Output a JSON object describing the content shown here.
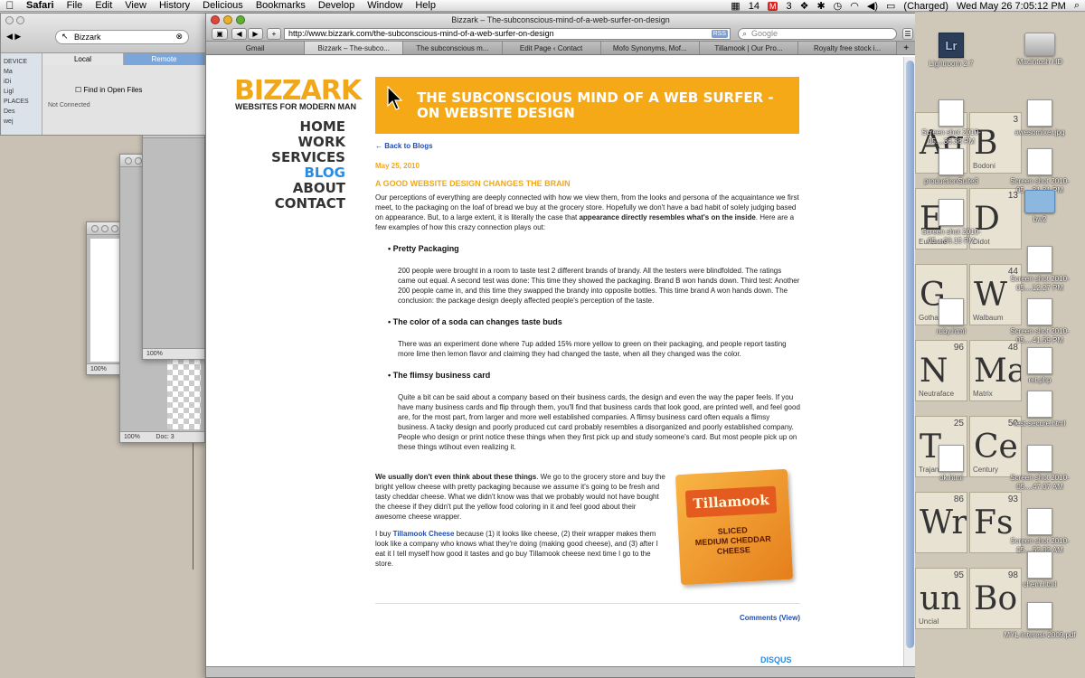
{
  "menubar": {
    "app": "Safari",
    "items": [
      "File",
      "Edit",
      "View",
      "History",
      "Delicious",
      "Bookmarks",
      "Develop",
      "Window",
      "Help"
    ],
    "status": {
      "mail_count": "14",
      "count2": "3",
      "battery": "(Charged)",
      "clock": "Wed May 26  7:05:12 PM"
    }
  },
  "finder": {
    "search_value": "Bizzark",
    "devices_label": "DEVICE",
    "places_label": "PLACES",
    "side_items": [
      "Ma",
      "iDi",
      "Ligl",
      "Des",
      "wej"
    ],
    "tabs": [
      "Local",
      "Remote"
    ],
    "find_in_open_files": "Find in Open Files",
    "status": "Not Connected"
  },
  "bg_windows": {
    "zoom_a": "100%",
    "zoom_b": "100%",
    "zoom_c": "100%",
    "doc": "Doc: 3"
  },
  "safari": {
    "title": "Bizzark – The-subconscious-mind-of-a-web-surfer-on-design",
    "url": "http://www.bizzark.com/the-subconscious-mind-of-a-web-surfer-on-design",
    "rss": "RSS",
    "search_placeholder": "Google",
    "tabs": [
      "Gmail",
      "Bizzark – The-subco...",
      "The subconscious m...",
      "Edit Page ‹ Contact",
      "Mofo Synonyms, Mof...",
      "Tillamook | Our Pro...",
      "Royalty free stock i..."
    ]
  },
  "site": {
    "logo": "BIZZARK",
    "tagline": "WEBSITES FOR MODERN MAN",
    "nav": [
      "HOME",
      "WORK",
      "SERVICES",
      "BLOG",
      "ABOUT",
      "CONTACT"
    ],
    "banner_title": "THE SUBCONSCIOUS MIND OF A WEB SURFER - ON WEBSITE DESIGN",
    "back_link": "← Back to Blogs",
    "date": "May 25, 2010",
    "post_heading": "A GOOD WEBSITE DESIGN CHANGES THE BRAIN",
    "intro": "Our perceptions of everything are deeply connected with how we view them, from the looks and persona of the acquaintance we first meet, to the packaging on the loaf of bread we buy at the grocery store. Hopefully we don't have a bad habit of solely judging based on appearance. But, to a large extent, it is literally the case that ",
    "intro_bold": "appearance directly resembles what's on the inside",
    "intro_tail": ". Here are a few examples of how this crazy connection plays out:",
    "bullets": [
      {
        "title": "Pretty Packaging",
        "text": "200 people were brought in a room to taste test 2 different brands of brandy. All the testers were blindfolded. The ratings came out equal. A second test was done: This time they showed the packaging. Brand B won hands down. Third test:  Another 200 people came in, and this time they swapped the brandy into opposite bottles. This time brand A won hands down. The conclusion: the package design deeply affected people's perception of the taste."
      },
      {
        "title": "The color of a soda can changes taste buds",
        "text": "There was an experiment done where 7up added 15% more yellow to green on their packaging, and people report tasting more lime then lemon flavor and claiming they had changed the taste, when all they changed was the color."
      },
      {
        "title": "The flimsy business card",
        "text": "Quite a bit can be said about a company based on their business cards, the design and even the way the paper feels. If you have many business cards and flip through them, you'll find that business cards that look good, are printed well, and feel good are, for the most part, from larger and more well established companies. A flimsy business card often equals a flimsy business. A tacky design and poorly produced cut card probably resembles a disorganized and poorly established company. People who design or print notice these things when they first pick up and study someone's card. But most people pick up on these things wtihout even realizing it."
      }
    ],
    "cheese_bold": "We usually don't even think about these things",
    "cheese_p1": ". We go to the grocery store and buy the bright yellow cheese with pretty packaging because we assume it's going to be fresh and tasty cheddar cheese. What we didn't know was that we probably would not have bought the cheese if they didn't put the yellow food coloring in it and feel good about their awesome cheese wrapper.",
    "cheese_p2a": "I buy ",
    "cheese_link": "Tillamook Cheese",
    "cheese_p2b": " because (1) it looks like cheese, (2) their wrapper makes them look like a company who knows what they're doing (making good cheese), and (3) after I eat it I tell myself how good it tastes and go buy Tillamook cheese next time I go to the store.",
    "cheese_brand": "Tillamook",
    "cheese_variety": "SLICED\nMEDIUM CHEDDAR CHEESE",
    "comments": "Comments (View)",
    "disqus": "DISQUS"
  },
  "desktop": {
    "icons": [
      {
        "label": "Lightroom 2.7",
        "icon": "lightroom-icon"
      },
      {
        "label": "Macintosh HD",
        "icon": "drive-icon"
      },
      {
        "label": "Screen shot 2010-05....36.38 PM",
        "icon": "screenshot-icon"
      },
      {
        "label": "awesomixer.jpg",
        "icon": "image-icon"
      },
      {
        "label": "productionSuite3",
        "icon": "image-icon"
      },
      {
        "label": "Screen shot 2010-05....31.31 PM",
        "icon": "screenshot-icon"
      },
      {
        "label": "Screen shot 2010-05....36.15 PM",
        "icon": "screenshot-icon"
      },
      {
        "label": "bw2",
        "icon": "folder-icon"
      },
      {
        "label": "Screen shot 2010-05....12.27 PM",
        "icon": "screenshot-icon"
      },
      {
        "label": "ruby.html",
        "icon": "html-icon"
      },
      {
        "label": "Screen shot 2010-05....41.59 PM",
        "icon": "screenshot-icon"
      },
      {
        "label": "ret.php",
        "icon": "php-icon"
      },
      {
        "label": "test-secure.html",
        "icon": "html-icon"
      },
      {
        "label": "ok.html",
        "icon": "html-icon"
      },
      {
        "label": "Screen shot 2010-05....47.07 AM",
        "icon": "screenshot-icon"
      },
      {
        "label": "Screen shot 2010-05....52.02 AM",
        "icon": "screenshot-icon"
      },
      {
        "label": "chem.html",
        "icon": "html-icon"
      },
      {
        "label": "MYL-interest-2009.pdf",
        "icon": "pdf-icon"
      }
    ],
    "type_cells": [
      {
        "sym": "Ag",
        "num": "22",
        "name": ""
      },
      {
        "sym": "B",
        "num": "3",
        "name": "Bodoni"
      },
      {
        "sym": "E",
        "num": "",
        "name": "Eurostile"
      },
      {
        "sym": "D",
        "num": "13",
        "name": "Didot"
      },
      {
        "sym": "G",
        "num": "",
        "name": "Gotham"
      },
      {
        "sym": "W",
        "num": "44",
        "name": "Walbaum"
      },
      {
        "sym": "N",
        "num": "96",
        "name": "Neutraface"
      },
      {
        "sym": "Ma",
        "num": "48",
        "name": "Matrix"
      },
      {
        "sym": "T",
        "num": "25",
        "name": "Trajan"
      },
      {
        "sym": "Ce",
        "num": "50",
        "name": "Century"
      },
      {
        "sym": "Wr",
        "num": "86",
        "name": ""
      },
      {
        "sym": "Fs",
        "num": "93",
        "name": ""
      },
      {
        "sym": "un",
        "num": "95",
        "name": "Uncial"
      },
      {
        "sym": "Bo",
        "num": "98",
        "name": ""
      }
    ]
  },
  "colors": {
    "accent": "#f6a917",
    "nav_active": "#2a8ce0",
    "link": "#1f4fb0"
  }
}
